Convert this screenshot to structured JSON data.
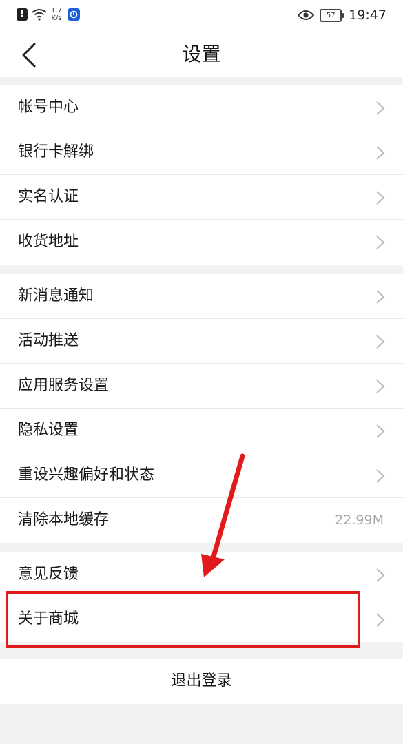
{
  "status_bar": {
    "speed_value": "1.7",
    "speed_unit": "K/s",
    "battery": "57",
    "time": "19:47"
  },
  "nav": {
    "title": "设置"
  },
  "groups": [
    {
      "items": [
        {
          "label": "帐号中心"
        },
        {
          "label": "银行卡解绑"
        },
        {
          "label": "实名认证"
        },
        {
          "label": "收货地址"
        }
      ]
    },
    {
      "items": [
        {
          "label": "新消息通知"
        },
        {
          "label": "活动推送"
        },
        {
          "label": "应用服务设置"
        },
        {
          "label": "隐私设置"
        },
        {
          "label": "重设兴趣偏好和状态"
        },
        {
          "label": "清除本地缓存",
          "value": "22.99M"
        }
      ]
    },
    {
      "items": [
        {
          "label": "意见反馈"
        },
        {
          "label": "关于商城"
        }
      ]
    }
  ],
  "logout_label": "退出登录",
  "colors": {
    "annotation_red": "#e11b1b",
    "page_background": "#f2f2f2",
    "chevron": "#b8b8b8"
  }
}
